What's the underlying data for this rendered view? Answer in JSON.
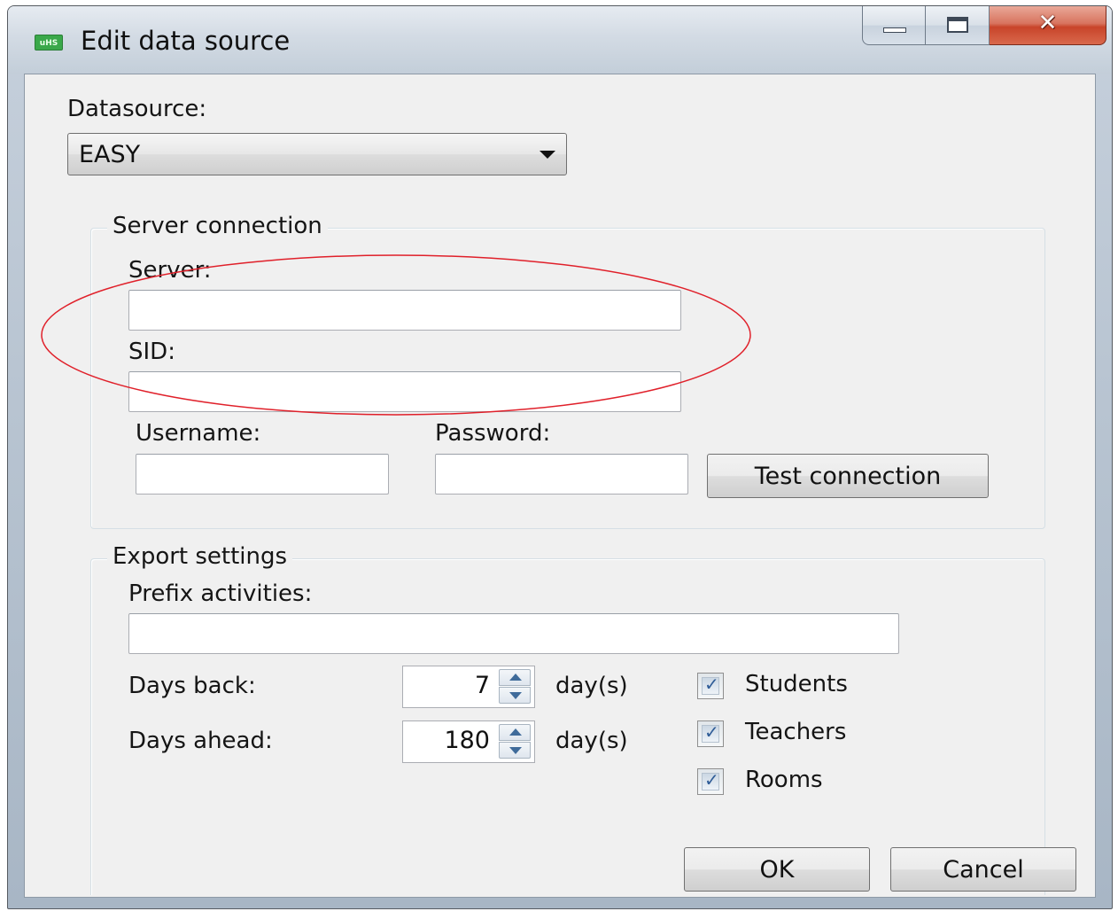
{
  "window": {
    "title": "Edit data source",
    "icon_text": "uHS",
    "caption_buttons": {
      "minimize": "minimize-icon",
      "maximize": "maximize-icon",
      "close": "✕"
    }
  },
  "datasource": {
    "label": "Datasource:",
    "selected": "EASY"
  },
  "server_connection": {
    "title": "Server connection",
    "server_label": "Server:",
    "server_value": "",
    "sid_label": "SID:",
    "sid_value": "",
    "username_label": "Username:",
    "username_value": "",
    "password_label": "Password:",
    "password_value": "",
    "test_button": "Test connection"
  },
  "export_settings": {
    "title": "Export settings",
    "prefix_label": "Prefix activities:",
    "prefix_value": "",
    "days_back_label": "Days back:",
    "days_back_value": "7",
    "days_ahead_label": "Days ahead:",
    "days_ahead_value": "180",
    "unit": "day(s)",
    "checkboxes": [
      {
        "label": "Students",
        "checked": true
      },
      {
        "label": "Teachers",
        "checked": true
      },
      {
        "label": "Rooms",
        "checked": true
      }
    ]
  },
  "footer": {
    "ok": "OK",
    "cancel": "Cancel"
  },
  "colors": {
    "annotation": "#e0202a",
    "close_button": "#c8442a",
    "checkmark": "#2f5c97"
  }
}
